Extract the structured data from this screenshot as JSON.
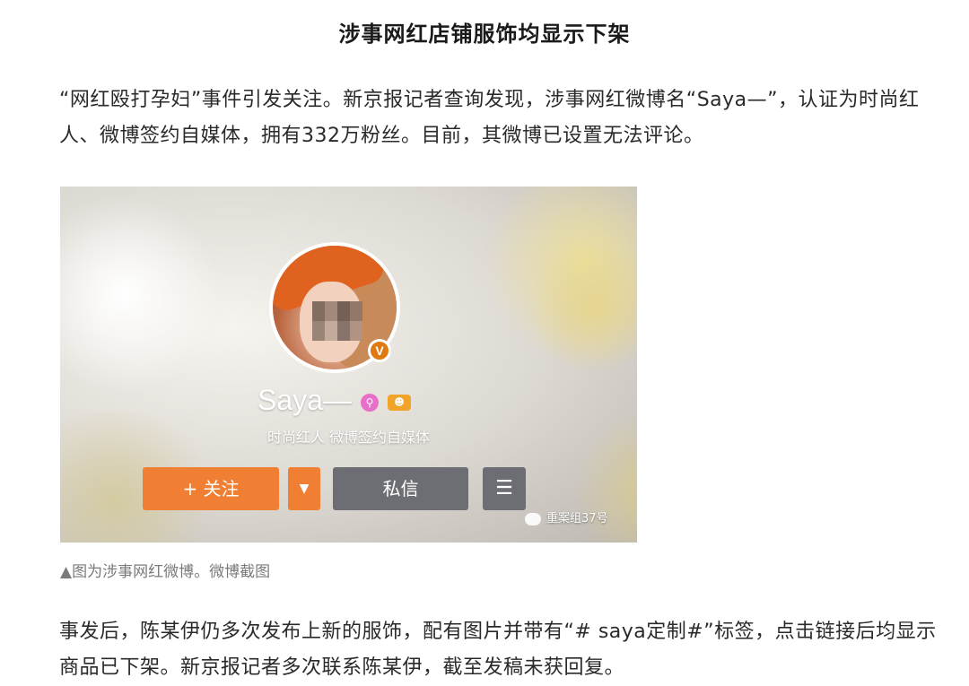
{
  "article": {
    "title": "涉事网红店铺服饰均显示下架",
    "paragraph1": "“网红殴打孕妇”事件引发关注。新京报记者查询发现，涉事网红微博名“Saya—”，认证为时尚红人、微博签约自媒体，拥有332万粉丝。目前，其微博已设置无法评论。",
    "caption": "▲图为涉事网红微博。微博截图",
    "paragraph2": "事发后，陈某伊仍多次发布上新的服饰，配有图片并带有“# saya定制#”标签，点击链接后均显示商品已下架。新京报记者多次联系陈某伊，截至发稿未获回复。"
  },
  "profile": {
    "verified_mark": "V",
    "username": "Saya—",
    "verification": "时尚红人 微博签约自媒体",
    "follow_label": "+ 关注",
    "dropdown_glyph": "▼",
    "message_label": "私信",
    "menu_glyph": "☰",
    "watermark": "重案组37号",
    "icons": [
      "search-icon",
      "fan-badge-icon"
    ]
  }
}
